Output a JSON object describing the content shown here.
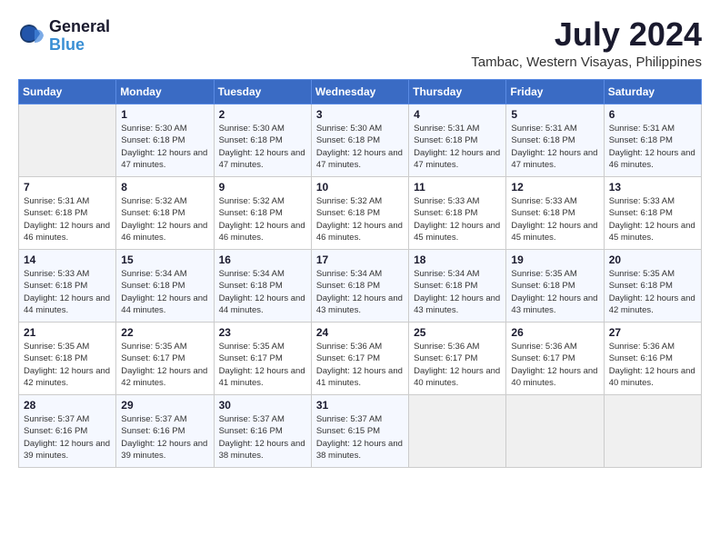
{
  "header": {
    "logo_line1": "General",
    "logo_line2": "Blue",
    "month_year": "July 2024",
    "location": "Tambac, Western Visayas, Philippines"
  },
  "weekdays": [
    "Sunday",
    "Monday",
    "Tuesday",
    "Wednesday",
    "Thursday",
    "Friday",
    "Saturday"
  ],
  "weeks": [
    [
      {
        "day": "",
        "sunrise": "",
        "sunset": "",
        "daylight": ""
      },
      {
        "day": "1",
        "sunrise": "Sunrise: 5:30 AM",
        "sunset": "Sunset: 6:18 PM",
        "daylight": "Daylight: 12 hours and 47 minutes."
      },
      {
        "day": "2",
        "sunrise": "Sunrise: 5:30 AM",
        "sunset": "Sunset: 6:18 PM",
        "daylight": "Daylight: 12 hours and 47 minutes."
      },
      {
        "day": "3",
        "sunrise": "Sunrise: 5:30 AM",
        "sunset": "Sunset: 6:18 PM",
        "daylight": "Daylight: 12 hours and 47 minutes."
      },
      {
        "day": "4",
        "sunrise": "Sunrise: 5:31 AM",
        "sunset": "Sunset: 6:18 PM",
        "daylight": "Daylight: 12 hours and 47 minutes."
      },
      {
        "day": "5",
        "sunrise": "Sunrise: 5:31 AM",
        "sunset": "Sunset: 6:18 PM",
        "daylight": "Daylight: 12 hours and 47 minutes."
      },
      {
        "day": "6",
        "sunrise": "Sunrise: 5:31 AM",
        "sunset": "Sunset: 6:18 PM",
        "daylight": "Daylight: 12 hours and 46 minutes."
      }
    ],
    [
      {
        "day": "7",
        "sunrise": "Sunrise: 5:31 AM",
        "sunset": "Sunset: 6:18 PM",
        "daylight": "Daylight: 12 hours and 46 minutes."
      },
      {
        "day": "8",
        "sunrise": "Sunrise: 5:32 AM",
        "sunset": "Sunset: 6:18 PM",
        "daylight": "Daylight: 12 hours and 46 minutes."
      },
      {
        "day": "9",
        "sunrise": "Sunrise: 5:32 AM",
        "sunset": "Sunset: 6:18 PM",
        "daylight": "Daylight: 12 hours and 46 minutes."
      },
      {
        "day": "10",
        "sunrise": "Sunrise: 5:32 AM",
        "sunset": "Sunset: 6:18 PM",
        "daylight": "Daylight: 12 hours and 46 minutes."
      },
      {
        "day": "11",
        "sunrise": "Sunrise: 5:33 AM",
        "sunset": "Sunset: 6:18 PM",
        "daylight": "Daylight: 12 hours and 45 minutes."
      },
      {
        "day": "12",
        "sunrise": "Sunrise: 5:33 AM",
        "sunset": "Sunset: 6:18 PM",
        "daylight": "Daylight: 12 hours and 45 minutes."
      },
      {
        "day": "13",
        "sunrise": "Sunrise: 5:33 AM",
        "sunset": "Sunset: 6:18 PM",
        "daylight": "Daylight: 12 hours and 45 minutes."
      }
    ],
    [
      {
        "day": "14",
        "sunrise": "Sunrise: 5:33 AM",
        "sunset": "Sunset: 6:18 PM",
        "daylight": "Daylight: 12 hours and 44 minutes."
      },
      {
        "day": "15",
        "sunrise": "Sunrise: 5:34 AM",
        "sunset": "Sunset: 6:18 PM",
        "daylight": "Daylight: 12 hours and 44 minutes."
      },
      {
        "day": "16",
        "sunrise": "Sunrise: 5:34 AM",
        "sunset": "Sunset: 6:18 PM",
        "daylight": "Daylight: 12 hours and 44 minutes."
      },
      {
        "day": "17",
        "sunrise": "Sunrise: 5:34 AM",
        "sunset": "Sunset: 6:18 PM",
        "daylight": "Daylight: 12 hours and 43 minutes."
      },
      {
        "day": "18",
        "sunrise": "Sunrise: 5:34 AM",
        "sunset": "Sunset: 6:18 PM",
        "daylight": "Daylight: 12 hours and 43 minutes."
      },
      {
        "day": "19",
        "sunrise": "Sunrise: 5:35 AM",
        "sunset": "Sunset: 6:18 PM",
        "daylight": "Daylight: 12 hours and 43 minutes."
      },
      {
        "day": "20",
        "sunrise": "Sunrise: 5:35 AM",
        "sunset": "Sunset: 6:18 PM",
        "daylight": "Daylight: 12 hours and 42 minutes."
      }
    ],
    [
      {
        "day": "21",
        "sunrise": "Sunrise: 5:35 AM",
        "sunset": "Sunset: 6:18 PM",
        "daylight": "Daylight: 12 hours and 42 minutes."
      },
      {
        "day": "22",
        "sunrise": "Sunrise: 5:35 AM",
        "sunset": "Sunset: 6:17 PM",
        "daylight": "Daylight: 12 hours and 42 minutes."
      },
      {
        "day": "23",
        "sunrise": "Sunrise: 5:35 AM",
        "sunset": "Sunset: 6:17 PM",
        "daylight": "Daylight: 12 hours and 41 minutes."
      },
      {
        "day": "24",
        "sunrise": "Sunrise: 5:36 AM",
        "sunset": "Sunset: 6:17 PM",
        "daylight": "Daylight: 12 hours and 41 minutes."
      },
      {
        "day": "25",
        "sunrise": "Sunrise: 5:36 AM",
        "sunset": "Sunset: 6:17 PM",
        "daylight": "Daylight: 12 hours and 40 minutes."
      },
      {
        "day": "26",
        "sunrise": "Sunrise: 5:36 AM",
        "sunset": "Sunset: 6:17 PM",
        "daylight": "Daylight: 12 hours and 40 minutes."
      },
      {
        "day": "27",
        "sunrise": "Sunrise: 5:36 AM",
        "sunset": "Sunset: 6:16 PM",
        "daylight": "Daylight: 12 hours and 40 minutes."
      }
    ],
    [
      {
        "day": "28",
        "sunrise": "Sunrise: 5:37 AM",
        "sunset": "Sunset: 6:16 PM",
        "daylight": "Daylight: 12 hours and 39 minutes."
      },
      {
        "day": "29",
        "sunrise": "Sunrise: 5:37 AM",
        "sunset": "Sunset: 6:16 PM",
        "daylight": "Daylight: 12 hours and 39 minutes."
      },
      {
        "day": "30",
        "sunrise": "Sunrise: 5:37 AM",
        "sunset": "Sunset: 6:16 PM",
        "daylight": "Daylight: 12 hours and 38 minutes."
      },
      {
        "day": "31",
        "sunrise": "Sunrise: 5:37 AM",
        "sunset": "Sunset: 6:15 PM",
        "daylight": "Daylight: 12 hours and 38 minutes."
      },
      {
        "day": "",
        "sunrise": "",
        "sunset": "",
        "daylight": ""
      },
      {
        "day": "",
        "sunrise": "",
        "sunset": "",
        "daylight": ""
      },
      {
        "day": "",
        "sunrise": "",
        "sunset": "",
        "daylight": ""
      }
    ]
  ]
}
